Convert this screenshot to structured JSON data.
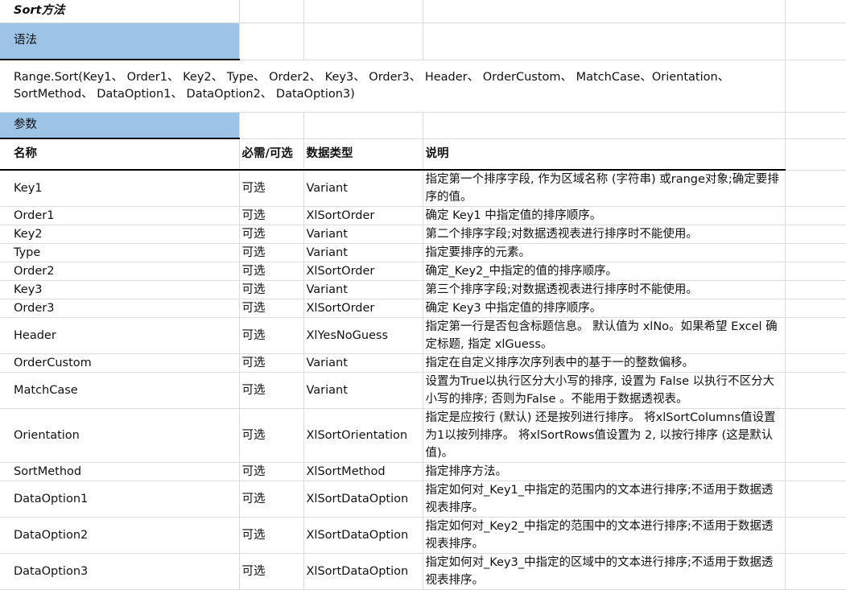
{
  "title": "Sort方法",
  "sections": {
    "syntax": "语法",
    "params": "参数"
  },
  "syntax_text": "Range.Sort(Key1、 Order1、 Key2、 Type、 Order2、 Key3、 Order3、 Header、 OrderCustom、 MatchCase、Orientation、 SortMethod、 DataOption1、 DataOption2、 DataOption3)",
  "headers": {
    "name": "名称",
    "required": "必需/可选",
    "type": "数据类型",
    "desc": "说明"
  },
  "params": [
    {
      "name": "Key1",
      "required": "可选",
      "type": "Variant",
      "desc": "指定第一个排序字段, 作为区域名称 (字符串) 或range对象;确定要排序的值。"
    },
    {
      "name": "Order1",
      "required": "可选",
      "type": "XlSortOrder",
      "desc": "确定 Key1 中指定值的排序顺序。"
    },
    {
      "name": "Key2",
      "required": "可选",
      "type": "Variant",
      "desc": "第二个排序字段;对数据透视表进行排序时不能使用。"
    },
    {
      "name": "Type",
      "required": "可选",
      "type": "Variant",
      "desc": "指定要排序的元素。"
    },
    {
      "name": "Order2",
      "required": "可选",
      "type": "XlSortOrder",
      "desc": "确定_Key2_中指定的值的排序顺序。"
    },
    {
      "name": "Key3",
      "required": "可选",
      "type": "Variant",
      "desc": "第三个排序字段;对数据透视表进行排序时不能使用。"
    },
    {
      "name": "Order3",
      "required": "可选",
      "type": "XlSortOrder",
      "desc": "确定 Key3 中指定值的排序顺序。"
    },
    {
      "name": "Header",
      "required": "可选",
      "type": "XlYesNoGuess",
      "desc": "指定第一行是否包含标题信息。 默认值为 xlNo。如果希望 Excel 确定标题, 指定 xlGuess。"
    },
    {
      "name": "OrderCustom",
      "required": "可选",
      "type": "Variant",
      "desc": "指定在自定义排序次序列表中的基于一的整数偏移。"
    },
    {
      "name": "MatchCase",
      "required": "可选",
      "type": "Variant",
      "desc": "设置为True以执行区分大小写的排序, 设置为 False 以执行不区分大小写的排序; 否则为False 。不能用于数据透视表。"
    },
    {
      "name": "Orientation",
      "required": "可选",
      "type": "XlSortOrientation",
      "desc": "指定是应按行 (默认) 还是按列进行排序。 将xlSortColumns值设置为1以按列排序。 将xlSortRows值设置为 2, 以按行排序 (这是默认值)。"
    },
    {
      "name": "SortMethod",
      "required": "可选",
      "type": "XlSortMethod",
      "desc": "指定排序方法。"
    },
    {
      "name": "DataOption1",
      "required": "可选",
      "type": "XlSortDataOption",
      "desc": "指定如何对_Key1_中指定的范围内的文本进行排序;不适用于数据透视表排序。"
    },
    {
      "name": "DataOption2",
      "required": "可选",
      "type": "XlSortDataOption",
      "desc": "指定如何对_Key2_中指定的范围中的文本进行排序;不适用于数据透视表排序。"
    },
    {
      "name": "DataOption3",
      "required": "可选",
      "type": "XlSortDataOption",
      "desc": "指定如何对_Key3_中指定的区域中的文本进行排序;不适用于数据透视表排序。"
    }
  ],
  "colors": {
    "section_fill": "#9dc3e6",
    "gridline": "#dcdcdc",
    "border_dark": "#000000"
  }
}
